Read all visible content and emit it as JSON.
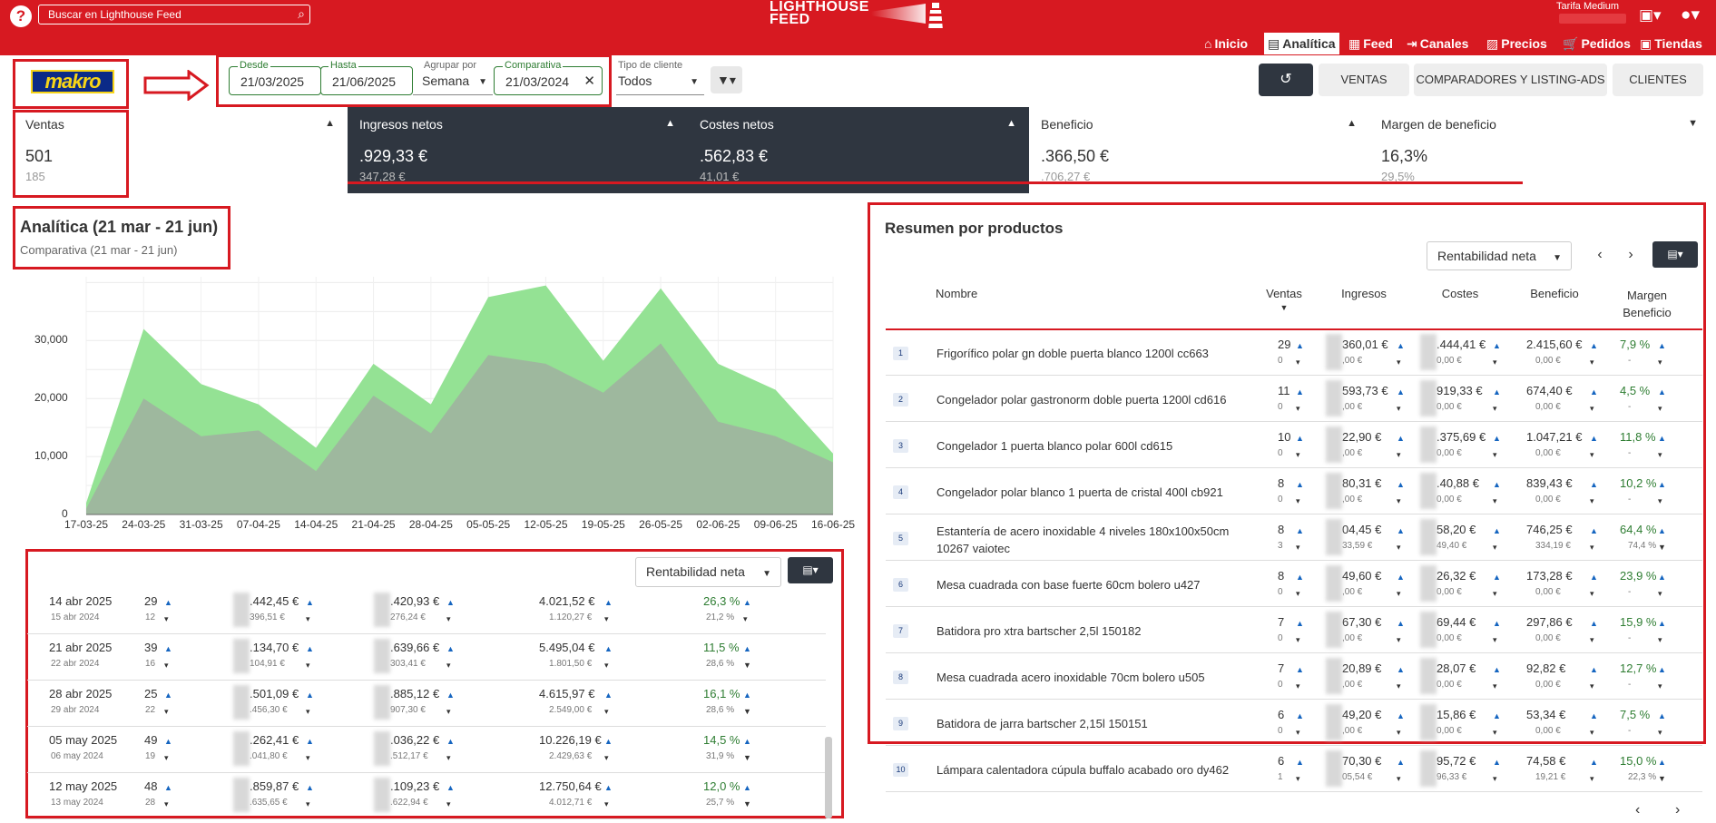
{
  "topbar": {
    "help": "?",
    "search_placeholder": "Buscar en Lighthouse Feed",
    "brand_line1": "LIGHTHOUSE",
    "brand_line2": "FEED",
    "tariff": "Tarifa Medium"
  },
  "nav": [
    {
      "label": "Inicio",
      "icon": "home-icon",
      "glyph": "⌂"
    },
    {
      "label": "Analítica",
      "icon": "analytics-icon",
      "glyph": "▤"
    },
    {
      "label": "Feed",
      "icon": "feed-icon",
      "glyph": "▦"
    },
    {
      "label": "Canales",
      "icon": "channels-icon",
      "glyph": "⇥"
    },
    {
      "label": "Precios",
      "icon": "prices-icon",
      "glyph": "▨"
    },
    {
      "label": "Pedidos",
      "icon": "cart-icon",
      "glyph": "🛒"
    },
    {
      "label": "Tiendas",
      "icon": "store-icon",
      "glyph": "▣"
    }
  ],
  "filters": {
    "brand_logo": "makro",
    "desde_label": "Desde",
    "desde": "21/03/2025",
    "hasta_label": "Hasta",
    "hasta": "21/06/2025",
    "agrupar_label": "Agrupar por",
    "agrupar": "Semana",
    "comparativa_label": "Comparativa",
    "comparativa": "21/03/2024",
    "tipo_label": "Tipo de cliente",
    "tipo": "Todos"
  },
  "buttons": {
    "ventas": "VENTAS",
    "comparadores": "COMPARADORES Y LISTING-ADS",
    "clientes": "CLIENTES"
  },
  "kpis": [
    {
      "title": "Ventas",
      "value": "501",
      "compare": "185"
    },
    {
      "title": "Ingresos netos",
      "value": ".929,33 €",
      "compare": "347,28 €"
    },
    {
      "title": "Costes netos",
      "value": ".562,83 €",
      "compare": "41,01 €"
    },
    {
      "title": "Beneficio",
      "value": ".366,50 €",
      "compare": ".706,27 €"
    },
    {
      "title": "Margen de beneficio",
      "value": "16,3%",
      "compare": "29,5%"
    }
  ],
  "analytics": {
    "title": "Analítica (21 mar - 21 jun)",
    "subtitle": "Comparativa (21 mar - 21 jun)"
  },
  "chart_data": {
    "type": "area",
    "x": [
      "17-03-25",
      "24-03-25",
      "31-03-25",
      "07-04-25",
      "14-04-25",
      "21-04-25",
      "28-04-25",
      "05-05-25",
      "12-05-25",
      "19-05-25",
      "26-05-25",
      "02-06-25",
      "09-06-25",
      "16-06-25"
    ],
    "series": [
      {
        "values": [
          2000,
          32000,
          22500,
          19000,
          11500,
          26000,
          19000,
          37500,
          39500,
          26500,
          39000,
          26000,
          21500,
          10500
        ],
        "color": "#8ee08e"
      },
      {
        "values": [
          1000,
          20000,
          13500,
          14500,
          7500,
          20500,
          14000,
          27500,
          26000,
          21000,
          29500,
          16000,
          13500,
          9000
        ],
        "color": "#9fb49f"
      }
    ],
    "yticks": [
      "0",
      "10,000",
      "20,000",
      "30,000"
    ],
    "ylim": [
      0,
      41000
    ],
    "grid": true
  },
  "weekly": {
    "dropdown": "Rentabilidad neta",
    "rows": [
      {
        "date": "14 abr 2025",
        "date_cmp": "15 abr 2024",
        "sales": "29",
        "sales_cmp": "12",
        "ing": ".442,45 €",
        "ing_cmp": "396,51 €",
        "cost": ".420,93 €",
        "cost_cmp": "276,24 €",
        "ben": "4.021,52 €",
        "ben_cmp": "1.120,27 €",
        "mar": "26,3 %",
        "mar_cmp": "21,2 %"
      },
      {
        "date": "21 abr 2025",
        "date_cmp": "22 abr 2024",
        "sales": "39",
        "sales_cmp": "16",
        "ing": ".134,70 €",
        "ing_cmp": "104,91 €",
        "cost": ".639,66 €",
        "cost_cmp": "303,41 €",
        "ben": "5.495,04 €",
        "ben_cmp": "1.801,50 €",
        "mar": "11,5 %",
        "mar_cmp": "28,6 %"
      },
      {
        "date": "28 abr 2025",
        "date_cmp": "29 abr 2024",
        "sales": "25",
        "sales_cmp": "22",
        "ing": ".501,09 €",
        "ing_cmp": ".456,30 €",
        "cost": ".885,12 €",
        "cost_cmp": "907,30 €",
        "ben": "4.615,97 €",
        "ben_cmp": "2.549,00 €",
        "mar": "16,1 %",
        "mar_cmp": "28,6 %"
      },
      {
        "date": "05 may 2025",
        "date_cmp": "06 may 2024",
        "sales": "49",
        "sales_cmp": "19",
        "ing": ".262,41 €",
        "ing_cmp": ".041,80 €",
        "cost": ".036,22 €",
        "cost_cmp": ".512,17 €",
        "ben": "10.226,19 €",
        "ben_cmp": "2.429,63 €",
        "mar": "14,5 %",
        "mar_cmp": "31,9 %"
      },
      {
        "date": "12 may 2025",
        "date_cmp": "13 may 2024",
        "sales": "48",
        "sales_cmp": "28",
        "ing": ".859,87 €",
        "ing_cmp": ".635,65 €",
        "cost": ".109,23 €",
        "cost_cmp": ".622,94 €",
        "ben": "12.750,64 €",
        "ben_cmp": "4.012,71 €",
        "mar": "12,0 %",
        "mar_cmp": "25,7 %"
      }
    ]
  },
  "products": {
    "title": "Resumen por productos",
    "dropdown": "Rentabilidad neta",
    "headers": {
      "nombre": "Nombre",
      "ventas": "Ventas",
      "ingresos": "Ingresos",
      "costes": "Costes",
      "beneficio": "Beneficio",
      "margen1": "Margen",
      "margen2": "Beneficio"
    },
    "rows": [
      {
        "rank": "1",
        "name": "Frigorífico polar gn doble puerta blanco 1200l cc663",
        "sales": "29",
        "sales_cmp": "0",
        "ing": "360,01 €",
        "ing_cmp": ",00 €",
        "cost": ".444,41 €",
        "cost_cmp": "0,00 €",
        "ben": "2.415,60 €",
        "ben_cmp": "0,00 €",
        "mar": "7,9 %",
        "mar_cmp": "-"
      },
      {
        "rank": "2",
        "name": "Congelador polar gastronorm doble puerta 1200l cd616",
        "sales": "11",
        "sales_cmp": "0",
        "ing": "593,73 €",
        "ing_cmp": ",00 €",
        "cost": "919,33 €",
        "cost_cmp": "0,00 €",
        "ben": "674,40 €",
        "ben_cmp": "0,00 €",
        "mar": "4,5 %",
        "mar_cmp": "-"
      },
      {
        "rank": "3",
        "name": "Congelador 1 puerta blanco polar 600l cd615",
        "sales": "10",
        "sales_cmp": "0",
        "ing": "22,90 €",
        "ing_cmp": ",00 €",
        "cost": ".375,69 €",
        "cost_cmp": "0,00 €",
        "ben": "1.047,21 €",
        "ben_cmp": "0,00 €",
        "mar": "11,8 %",
        "mar_cmp": "-"
      },
      {
        "rank": "4",
        "name": "Congelador polar blanco 1 puerta de cristal 400l cb921",
        "sales": "8",
        "sales_cmp": "0",
        "ing": "80,31 €",
        "ing_cmp": ",00 €",
        "cost": ".40,88 €",
        "cost_cmp": "0,00 €",
        "ben": "839,43 €",
        "ben_cmp": "0,00 €",
        "mar": "10,2 %",
        "mar_cmp": "-"
      },
      {
        "rank": "5",
        "name": "Estantería de acero inoxidable 4 niveles 180x100x50cm 10267 vaiotec",
        "sales": "8",
        "sales_cmp": "3",
        "ing": "04,45 €",
        "ing_cmp": "33,59 €",
        "cost": "58,20 €",
        "cost_cmp": "49,40 €",
        "ben": "746,25 €",
        "ben_cmp": "334,19 €",
        "mar": "64,4 %",
        "mar_cmp": "74,4 %"
      },
      {
        "rank": "6",
        "name": "Mesa cuadrada con base fuerte 60cm bolero u427",
        "sales": "8",
        "sales_cmp": "0",
        "ing": "49,60 €",
        "ing_cmp": ",00 €",
        "cost": "26,32 €",
        "cost_cmp": "0,00 €",
        "ben": "173,28 €",
        "ben_cmp": "0,00 €",
        "mar": "23,9 %",
        "mar_cmp": "-"
      },
      {
        "rank": "7",
        "name": "Batidora pro xtra bartscher 2,5l 150182",
        "sales": "7",
        "sales_cmp": "0",
        "ing": "67,30 €",
        "ing_cmp": ",00 €",
        "cost": "69,44 €",
        "cost_cmp": "0,00 €",
        "ben": "297,86 €",
        "ben_cmp": "0,00 €",
        "mar": "15,9 %",
        "mar_cmp": "-"
      },
      {
        "rank": "8",
        "name": "Mesa cuadrada acero inoxidable 70cm bolero u505",
        "sales": "7",
        "sales_cmp": "0",
        "ing": "20,89 €",
        "ing_cmp": ",00 €",
        "cost": "28,07 €",
        "cost_cmp": "0,00 €",
        "ben": "92,82 €",
        "ben_cmp": "0,00 €",
        "mar": "12,7 %",
        "mar_cmp": "-"
      },
      {
        "rank": "9",
        "name": "Batidora de jarra bartscher 2,15l 150151",
        "sales": "6",
        "sales_cmp": "0",
        "ing": "49,20 €",
        "ing_cmp": ",00 €",
        "cost": "15,86 €",
        "cost_cmp": "0,00 €",
        "ben": "53,34 €",
        "ben_cmp": "0,00 €",
        "mar": "7,5 %",
        "mar_cmp": "-"
      },
      {
        "rank": "10",
        "name": "Lámpara calentadora cúpula buffalo acabado oro dy462",
        "sales": "6",
        "sales_cmp": "1",
        "ing": "70,30 €",
        "ing_cmp": "05,54 €",
        "cost": "95,72 €",
        "cost_cmp": "96,33 €",
        "ben": "74,58 €",
        "ben_cmp": "19,21 €",
        "mar": "15,0 %",
        "mar_cmp": "22,3 %"
      }
    ]
  }
}
